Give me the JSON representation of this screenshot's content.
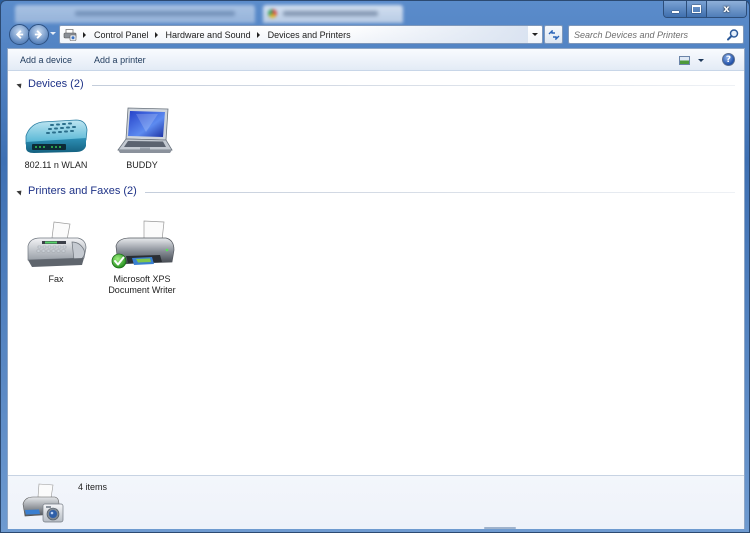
{
  "window": {
    "caption_buttons": {
      "minimize": "minimize",
      "maximize": "maximize",
      "close": "x"
    }
  },
  "navigation": {
    "back_icon": "back-arrow-icon",
    "forward_icon": "forward-arrow-icon",
    "breadcrumb": [
      {
        "label": "Control Panel"
      },
      {
        "label": "Hardware and Sound"
      },
      {
        "label": "Devices and Printers"
      }
    ],
    "refresh_icon": "refresh-icon",
    "search": {
      "placeholder": "Search Devices and Printers",
      "value": ""
    }
  },
  "command_bar": {
    "add_device_label": "Add a device",
    "add_printer_label": "Add a printer",
    "help_label": "?"
  },
  "groups": [
    {
      "title": "Devices (2)",
      "items": [
        {
          "label": "802.11 n WLAN",
          "icon": "wireless-adapter-icon"
        },
        {
          "label": "BUDDY",
          "icon": "laptop-icon"
        }
      ]
    },
    {
      "title": "Printers and Faxes (2)",
      "items": [
        {
          "label": "Fax",
          "icon": "fax-icon"
        },
        {
          "label": "Microsoft XPS Document Writer",
          "icon": "printer-icon",
          "default": true
        }
      ]
    }
  ],
  "details_pane": {
    "item_count": "4 items"
  }
}
